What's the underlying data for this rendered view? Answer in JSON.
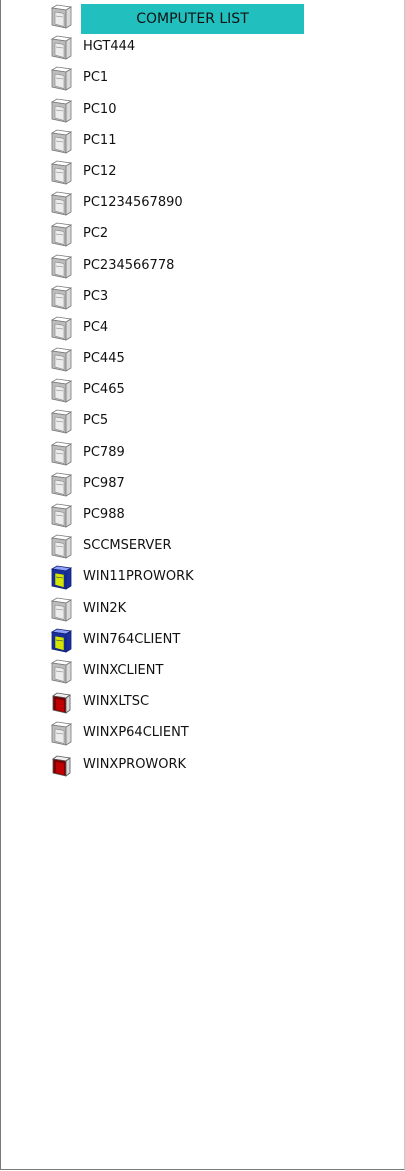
{
  "header": {
    "label": "COMPUTER LIST",
    "color": "#21c0bf",
    "icon": "computer-tower-icon"
  },
  "computers": [
    {
      "name": "HGT444",
      "status": "gray"
    },
    {
      "name": "PC1",
      "status": "gray"
    },
    {
      "name": "PC10",
      "status": "gray"
    },
    {
      "name": "PC11",
      "status": "gray"
    },
    {
      "name": "PC12",
      "status": "gray"
    },
    {
      "name": "PC1234567890",
      "status": "gray"
    },
    {
      "name": "PC2",
      "status": "gray"
    },
    {
      "name": "PC234566778",
      "status": "gray"
    },
    {
      "name": "PC3",
      "status": "gray"
    },
    {
      "name": "PC4",
      "status": "gray"
    },
    {
      "name": "PC445",
      "status": "gray"
    },
    {
      "name": "PC465",
      "status": "gray"
    },
    {
      "name": "PC5",
      "status": "gray"
    },
    {
      "name": "PC789",
      "status": "gray"
    },
    {
      "name": "PC987",
      "status": "gray"
    },
    {
      "name": "PC988",
      "status": "gray"
    },
    {
      "name": "SCCMSERVER",
      "status": "gray"
    },
    {
      "name": "WIN11PROWORK",
      "status": "online"
    },
    {
      "name": "WIN2K",
      "status": "gray"
    },
    {
      "name": "WIN764CLIENT",
      "status": "online"
    },
    {
      "name": "WINXCLIENT",
      "status": "gray"
    },
    {
      "name": "WINXLTSC",
      "status": "red"
    },
    {
      "name": "WINXP64CLIENT",
      "status": "gray"
    },
    {
      "name": "WINXPROWORK",
      "status": "red"
    }
  ],
  "status_colors": {
    "gray": {
      "front": "#ececec",
      "side": "#bdbdbd",
      "top": "#ffffff",
      "stroke": "#777777"
    },
    "online": {
      "front": "#d4e600",
      "side": "#1a2f9e",
      "top": "#8fa0ff",
      "stroke": "#10206e"
    },
    "red": {
      "front": "#c00000",
      "side": "#7a0000",
      "top": "#f0f0f0",
      "stroke": "#555555"
    }
  },
  "status_icons": {
    "gray": "gray-computer-icon",
    "online": "online-computer-icon",
    "red": "red-computer-icon"
  }
}
